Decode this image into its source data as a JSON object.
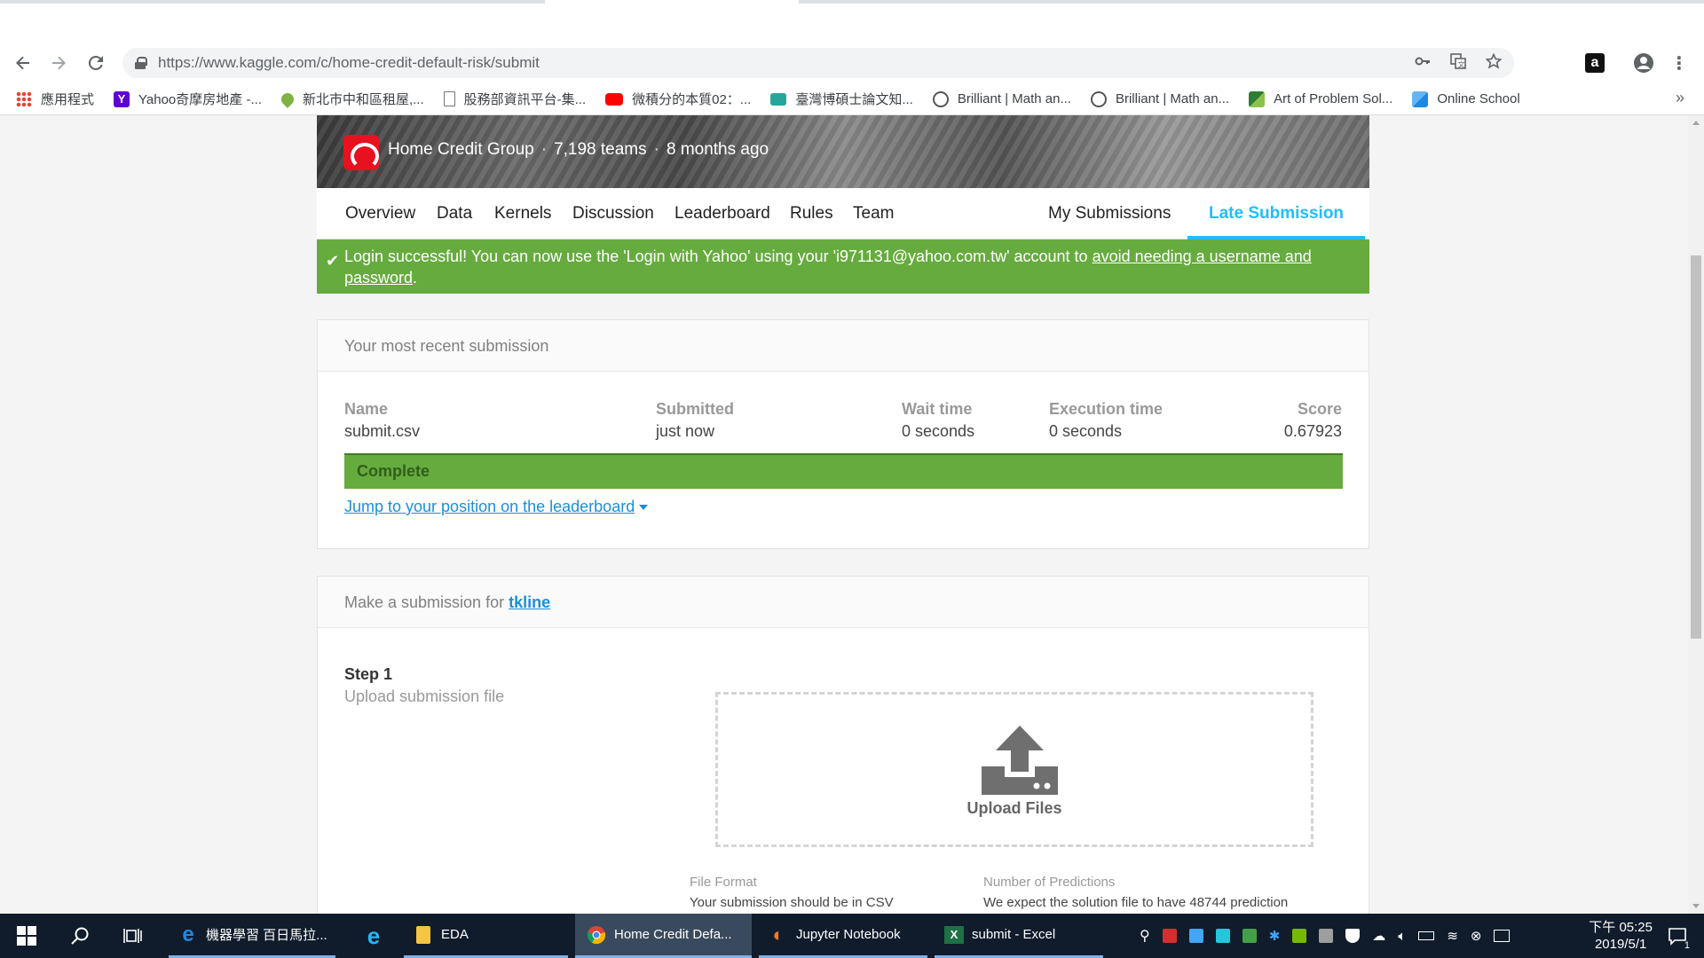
{
  "browser": {
    "url": "https://www.kaggle.com/c/home-credit-default-risk/submit",
    "bookmarks": [
      {
        "label": "應用程式",
        "color": "#ea4335"
      },
      {
        "label": "Yahoo奇摩房地產 -...",
        "color": "#5f01d1"
      },
      {
        "label": "新北市中和區租屋,...",
        "color": "#7cb342"
      },
      {
        "label": "股務部資訊平台-集...",
        "color": "#9e9e9e"
      },
      {
        "label": "微積分的本質02：...",
        "color": "#ff0000"
      },
      {
        "label": "臺灣博碩士論文知...",
        "color": "#26a69a"
      },
      {
        "label": "Brilliant | Math an...",
        "color": "#555555"
      },
      {
        "label": "Brilliant | Math an...",
        "color": "#555555"
      },
      {
        "label": "Art of Problem Sol...",
        "color": "#2e7d32"
      },
      {
        "label": "Online School",
        "color": "#1e88e5"
      }
    ],
    "bookmarks_more": "»"
  },
  "competition": {
    "org": "Home Credit Group",
    "teams": "7,198 teams",
    "age": "8 months ago"
  },
  "tabs": {
    "overview": "Overview",
    "data": "Data",
    "kernels": "Kernels",
    "discussion": "Discussion",
    "leaderboard": "Leaderboard",
    "rules": "Rules",
    "team": "Team",
    "my_submissions": "My Submissions",
    "late_submission": "Late Submission"
  },
  "alert": {
    "text": "Login successful! You can now use the 'Login with Yahoo' using your 'i971131@yahoo.com.tw' account to ",
    "link": "avoid needing a username and password",
    "tail": "."
  },
  "recent": {
    "heading": "Your most recent submission",
    "name_label": "Name",
    "name_value": "submit.csv",
    "submitted_label": "Submitted",
    "submitted_value": "just now",
    "wait_label": "Wait time",
    "wait_value": "0 seconds",
    "exec_label": "Execution time",
    "exec_value": "0 seconds",
    "score_label": "Score",
    "score_value": "0.67923",
    "status": "Complete",
    "jump_link": "Jump to your position on the leaderboard"
  },
  "make": {
    "heading": "Make a submission for ",
    "user": "tkline",
    "step_title": "Step 1",
    "step_sub": "Upload submission file",
    "upload_label": "Upload Files",
    "file_format_label": "File Format",
    "file_format_text": "Your submission should be in CSV",
    "predictions_label": "Number of Predictions",
    "predictions_text": "We expect the solution file to have 48744 prediction"
  },
  "taskbar": {
    "items": [
      {
        "label": "機器學習 百日馬拉..."
      },
      {
        "label": "EDA"
      },
      {
        "label": "Home Credit Defa..."
      },
      {
        "label": "Jupyter Notebook"
      },
      {
        "label": "submit - Excel"
      }
    ],
    "time": "下午 05:25",
    "date": "2019/5/1",
    "notif_count": "1"
  },
  "colors": {
    "accent": "#20beff",
    "success": "#66ab3e",
    "link": "#1a8fd8"
  }
}
